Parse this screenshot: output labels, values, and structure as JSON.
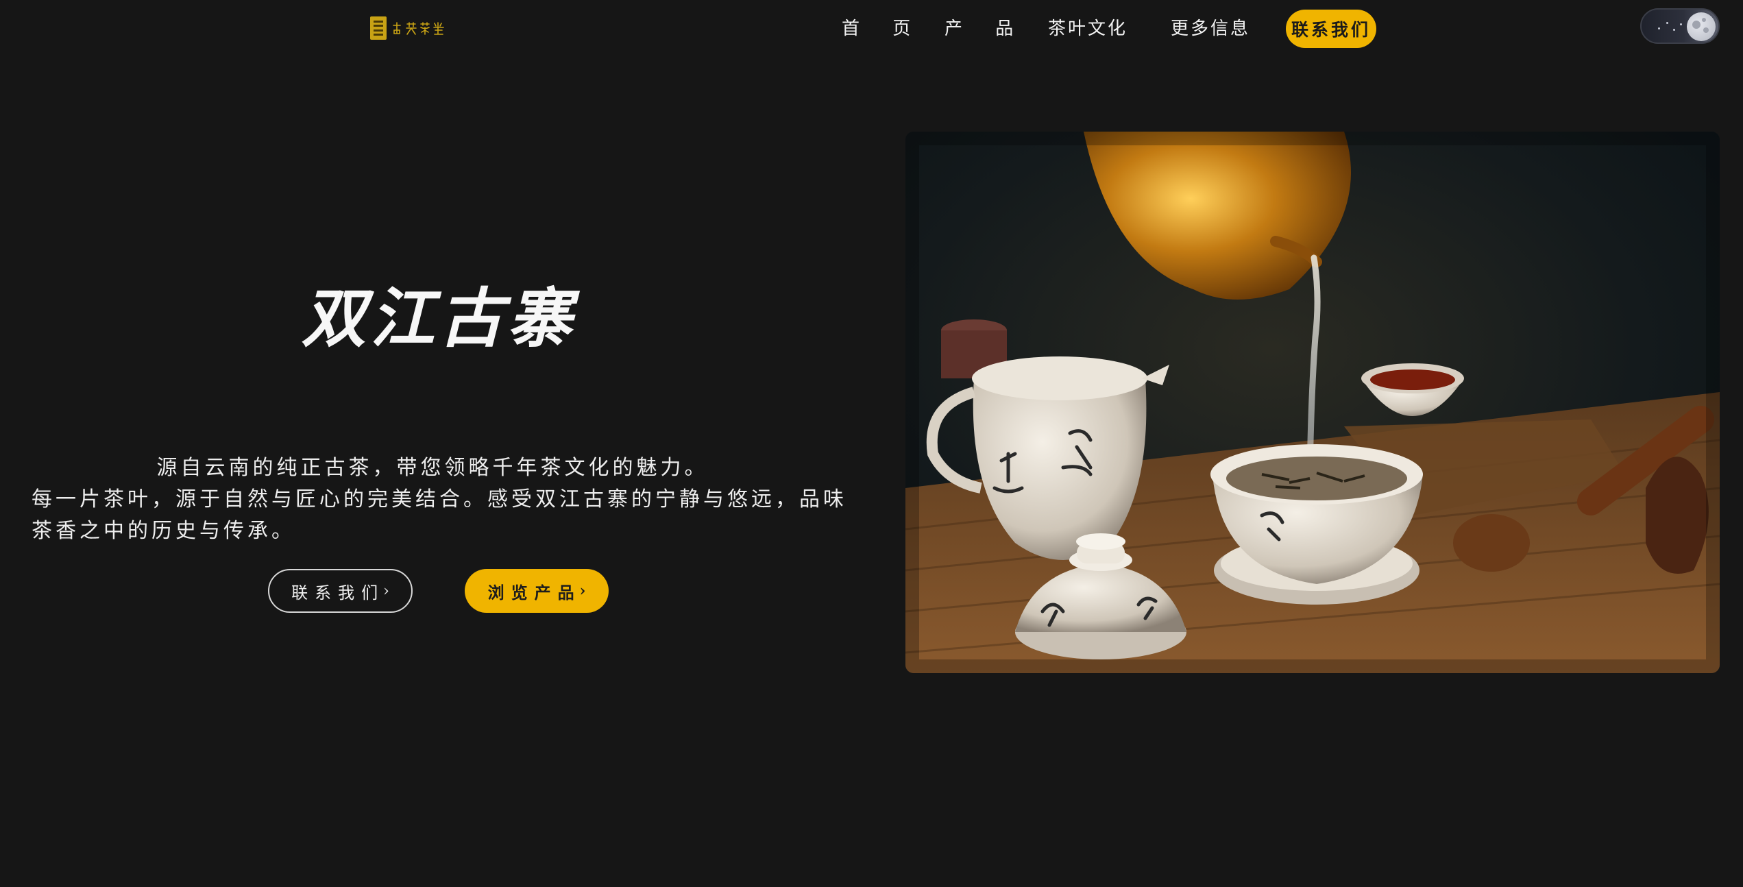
{
  "header": {
    "logo": {
      "text": "古寨茶業",
      "alt": "双江古寨 logo"
    },
    "nav": [
      {
        "id": "home",
        "label": "首 页"
      },
      {
        "id": "products",
        "label": "产 品"
      },
      {
        "id": "culture",
        "label": "茶叶文化"
      },
      {
        "id": "more",
        "label": "更多信息"
      }
    ],
    "cta_label": "联系我们",
    "theme_toggle": {
      "state": "dark",
      "icon": "moon-icon"
    }
  },
  "hero": {
    "title": "双江古寨",
    "description_line1": "源自云南的纯正古茶，带您领略千年茶文化的魅力。",
    "description_line2": "每一片茶叶，源于自然与匠心的完美结合。感受双江古寨的宁静与悠远，品味茶香之中的历史与传承。",
    "buttons": {
      "contact_label": "联系我们",
      "browse_label": "浏览产品",
      "chevron": "›"
    },
    "image": {
      "icon": "tea-ceremony-photo"
    }
  },
  "colors": {
    "background": "#161616",
    "accent": "#f0b400",
    "text": "#f2f2f2"
  }
}
